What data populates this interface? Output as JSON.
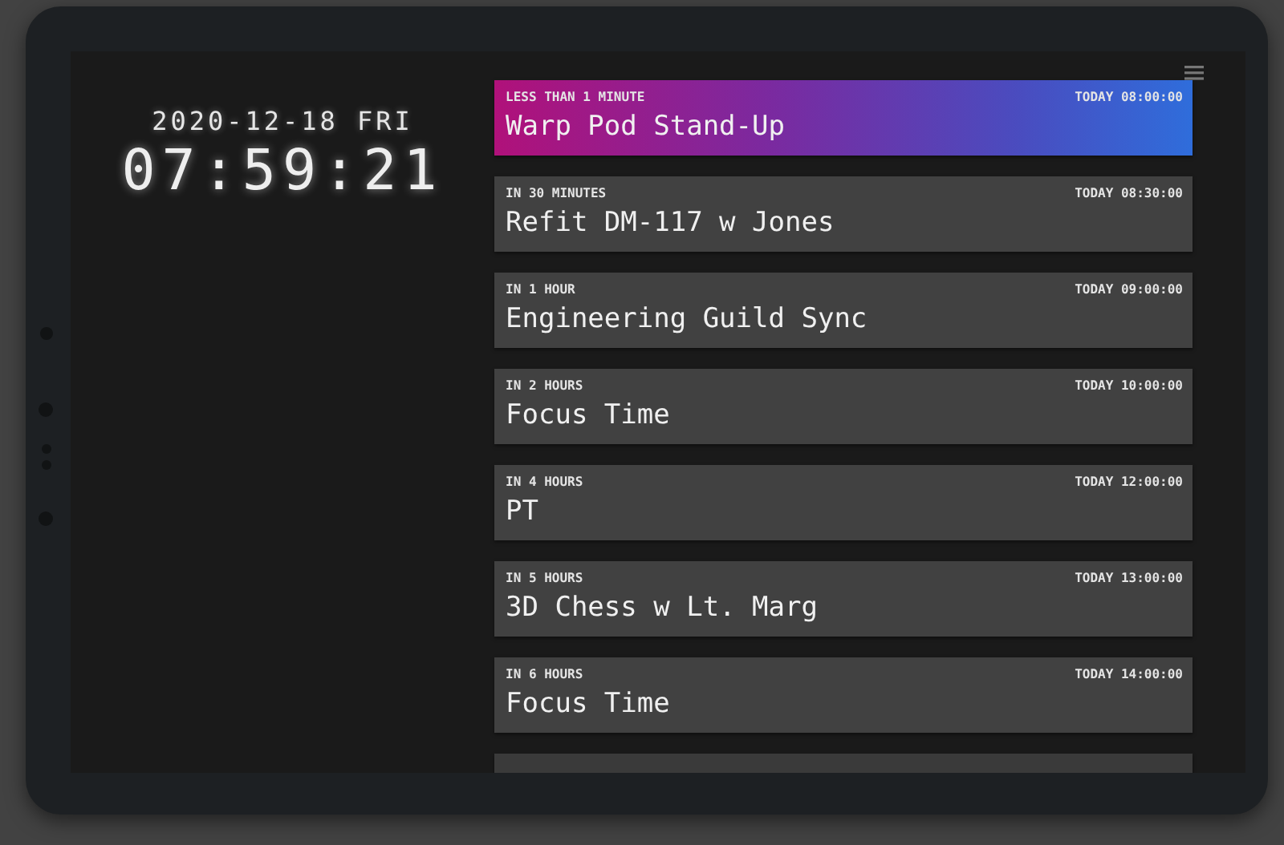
{
  "clock": {
    "date": "2020-12-18 FRI",
    "time": "07:59:21"
  },
  "events": [
    {
      "kind": "imminent",
      "relative": "LESS THAN 1 MINUTE",
      "when": "TODAY 08:00:00",
      "title": "Warp Pod Stand-Up"
    },
    {
      "kind": "upcoming",
      "relative": "IN 30 MINUTES",
      "when": "TODAY 08:30:00",
      "title": "Refit DM-117 w Jones"
    },
    {
      "kind": "upcoming",
      "relative": "IN 1 HOUR",
      "when": "TODAY 09:00:00",
      "title": "Engineering Guild Sync"
    },
    {
      "kind": "upcoming",
      "relative": "IN 2 HOURS",
      "when": "TODAY 10:00:00",
      "title": "Focus Time"
    },
    {
      "kind": "upcoming",
      "relative": "IN 4 HOURS",
      "when": "TODAY 12:00:00",
      "title": "PT"
    },
    {
      "kind": "upcoming",
      "relative": "IN 5 HOURS",
      "when": "TODAY 13:00:00",
      "title": "3D Chess w Lt. Marg"
    },
    {
      "kind": "upcoming",
      "relative": "IN 6 HOURS",
      "when": "TODAY 14:00:00",
      "title": "Focus Time"
    },
    {
      "kind": "cut"
    }
  ]
}
